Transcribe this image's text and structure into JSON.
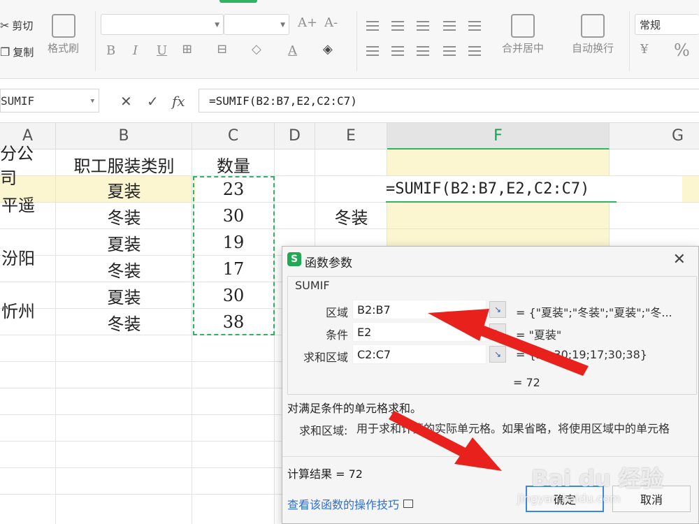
{
  "ribbon": {
    "cut_label": "剪切",
    "copy_label": "复制",
    "format_painter_label": "格式刷",
    "merge_center_label": "合并居中",
    "wrap_text_label": "自动换行",
    "number_format_value": "常规",
    "bold": "B",
    "italic": "I",
    "underline": "U",
    "grow_font": "A+",
    "shrink_font": "A-",
    "font_color_letter": "A",
    "currency_symbol": "¥",
    "percent_symbol": "%"
  },
  "formula_bar": {
    "name_box": "SUMIF",
    "fx": "fx",
    "formula": "=SUMIF(B2:B7,E2,C2:C7)"
  },
  "columns": [
    "A",
    "B",
    "C",
    "D",
    "E",
    "F",
    "G"
  ],
  "sheet": {
    "header_a": "分公司",
    "header_b": "职工服装类别",
    "header_c": "数量",
    "companies": [
      "平遥",
      "汾阳",
      "忻州"
    ],
    "categories": [
      "夏装",
      "冬装",
      "夏装",
      "冬装",
      "夏装",
      "冬装"
    ],
    "quantities": [
      "23",
      "30",
      "19",
      "17",
      "30",
      "38"
    ],
    "e3": "冬装",
    "f2": "=SUMIF(B2:B7,E2,C2:C7)"
  },
  "dialog": {
    "title": "函数参数",
    "function_name": "SUMIF",
    "args": [
      {
        "label": "区域",
        "value": "B2:B7",
        "result": "= {\"夏装\";\"冬装\";\"夏装\";\"冬..."
      },
      {
        "label": "条件",
        "value": "E2",
        "result": "= \"夏装\""
      },
      {
        "label": "求和区域",
        "value": "C2:C7",
        "result": "= {23;30;19;17;30;38}"
      }
    ],
    "result_small": "= 72",
    "description": "对满足条件的单元格求和。",
    "param_label": "求和区域:",
    "param_desc": "用于求和计算的实际单元格。如果省略，将使用区域中的单元格",
    "calc_result": "计算结果 = 72",
    "help_link": "查看该函数的操作技巧",
    "ok": "确定",
    "cancel": "取消"
  },
  "watermark": {
    "brand": "Bai du 经验",
    "url": "jingyan.baidu.com"
  },
  "colors": {
    "accent_green": "#2fb463",
    "highlight_yellow": "#fbf6cf",
    "arrow_red": "#e8211c",
    "link_blue": "#2f6fd0"
  }
}
